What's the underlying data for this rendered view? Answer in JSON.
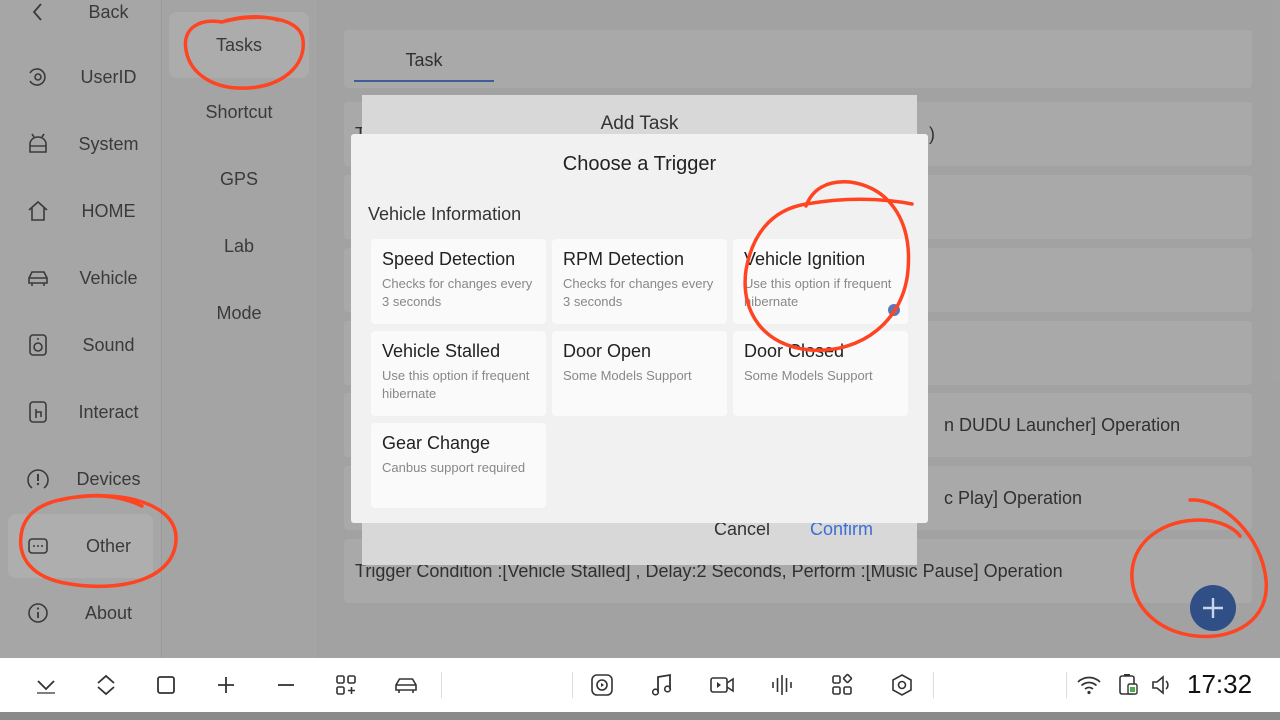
{
  "nav": {
    "items": [
      {
        "label": "Back",
        "icon": "back-icon"
      },
      {
        "label": "UserID",
        "icon": "userid-icon"
      },
      {
        "label": "System",
        "icon": "android-icon"
      },
      {
        "label": "HOME",
        "icon": "home-icon"
      },
      {
        "label": "Vehicle",
        "icon": "car-icon"
      },
      {
        "label": "Sound",
        "icon": "speaker-icon"
      },
      {
        "label": "Interact",
        "icon": "touch-icon"
      },
      {
        "label": "Devices",
        "icon": "alert-icon"
      },
      {
        "label": "Other",
        "icon": "message-icon"
      },
      {
        "label": "About",
        "icon": "info-icon"
      }
    ],
    "active": "Other"
  },
  "subnav": {
    "items": [
      "Tasks",
      "Shortcut",
      "GPS",
      "Lab",
      "Mode"
    ],
    "active": "Tasks"
  },
  "main": {
    "tab": "Task",
    "rows": [
      "T",
      "",
      "",
      "",
      "n DUDU Launcher] Operation",
      "c Play] Operation",
      "Trigger Condition :[Vehicle Stalled] , Delay:2 Seconds, Perform :[Music Pause] Operation"
    ],
    "row1_tail": ")"
  },
  "add_task": {
    "title": "Add Task",
    "cancel": "Cancel",
    "confirm": "Confirm"
  },
  "trigger_modal": {
    "title": "Choose a Trigger",
    "section": "Vehicle Information",
    "options": [
      {
        "title": "Speed Detection",
        "desc": "Checks for changes every 3 seconds"
      },
      {
        "title": "RPM Detection",
        "desc": "Checks for changes every 3 seconds"
      },
      {
        "title": "Vehicle Ignition",
        "desc": "Use this option if frequent hibernate",
        "selected": true
      },
      {
        "title": "Vehicle Stalled",
        "desc": "Use this option if frequent hibernate"
      },
      {
        "title": "Door Open",
        "desc": "Some Models Support"
      },
      {
        "title": "Door Closed",
        "desc": "Some Models Support"
      },
      {
        "title": "Gear Change",
        "desc": "Canbus support required"
      }
    ]
  },
  "fab_icon": "plus-icon",
  "sysbar": {
    "left_icons": [
      "chevron-down-icon",
      "collapse-icon",
      "square-icon",
      "plus-icon",
      "minus-icon",
      "apps-add-icon",
      "car-icon"
    ],
    "center_icons": [
      "media-app-icon",
      "music-icon",
      "video-icon",
      "audio-bars-icon",
      "apps-icon",
      "settings-hex-icon"
    ],
    "right_icons": [
      "wifi-icon",
      "battery-icon",
      "volume-icon"
    ],
    "time": "17:32"
  },
  "colors": {
    "accent": "#3b6fd6",
    "fab": "#2f4f86",
    "annotation": "#ff4422",
    "selected_dot": "#5c76b8"
  }
}
